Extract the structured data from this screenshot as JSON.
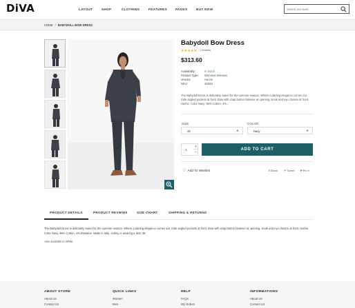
{
  "brand": {
    "logo": "DiVA",
    "accent": "#2bb3b1"
  },
  "nav": [
    "LAYOUT",
    "SHOP",
    "CLOTHING",
    "FEATURES",
    "PAGES",
    "BUY NOW"
  ],
  "search": {
    "placeholder": "Search our store",
    "icon": "search-icon"
  },
  "breadcrumb": {
    "home": "HOME",
    "separator": "/",
    "current": "BABYDOLL BOW DRESS"
  },
  "product": {
    "title": "Babydoll Bow Dress",
    "rating": 5,
    "rating_stars": "★★★★★",
    "reviews": "1 reviews",
    "price": "$313.60",
    "meta": [
      {
        "key": "Availability:",
        "value": "In Stock",
        "color": "#3a9a3a"
      },
      {
        "key": "Product Type:",
        "value": "Womens Dresses"
      },
      {
        "key": "Vendor:",
        "value": "Hache"
      },
      {
        "key": "SKU:",
        "value": "4556S"
      }
    ],
    "description": "The Babydoll Dress is delicately sweet for the summer season. Where a darling elegance comes out. Side angled pockets at front. Bow with snap button fastener at opening. Hook and eye closure at front. Hache. Color Navy. 96% Cotton, 4%...",
    "options": {
      "size_label": "SIZE",
      "size_value": "44",
      "color_label": "COLOR",
      "color_value": "Navy"
    },
    "quantity": "1",
    "add_to_cart": "ADD TO CART",
    "wishlist": "Add To Wishlist",
    "share": {
      "share": "Share",
      "tweet": "Tweet",
      "pin": "Pin it"
    },
    "colors": {
      "primary": "#1d5f66",
      "star": "#f2a71b"
    }
  },
  "tabs": {
    "items": [
      "PRODUCT DETAILS",
      "PRODUCT REVIEWS",
      "SIZE CHART",
      "SHIPPING & RETURNS"
    ],
    "active": "PRODUCT DETAILS",
    "content": "The Babydoll Dress is delicately sweet for the summer season. Where a darling elegance comes out. Side angled pockets at front. Bow with snap button fastener at opening. Hook and eye closure at front. Hache. Color Navy. 96% Cotton, 4% Elastane. Made in Italy.",
    "content_italic": " Ashley is wearing a Size 38.",
    "also": "Also available in White."
  },
  "footer": {
    "columns": [
      {
        "title": "ABOUT STORE",
        "links": [
          "About Us",
          "Contact Us"
        ]
      },
      {
        "title": "QUICK LINKS",
        "links": [
          "Women",
          "Men"
        ]
      },
      {
        "title": "HELP",
        "links": [
          "FAQs",
          "My Orders"
        ]
      },
      {
        "title": "INFORMATIONS",
        "links": [
          "About Us",
          "Contact Us"
        ]
      }
    ]
  }
}
